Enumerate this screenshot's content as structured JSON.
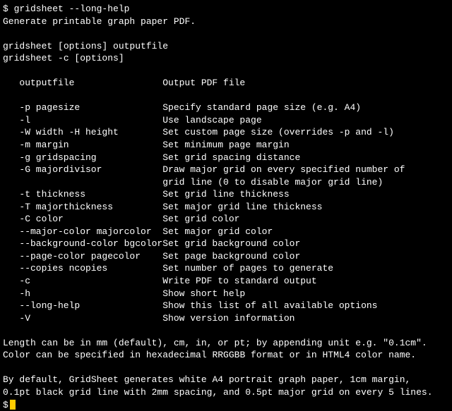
{
  "cmd_line": "$ gridsheet --long-help",
  "summary": "Generate printable graph paper PDF.",
  "usage1": "gridsheet [options] outputfile",
  "usage2": "gridsheet -c [options]",
  "options": [
    {
      "key": "outputfile",
      "desc": "Output PDF file"
    },
    {
      "key": "",
      "desc": ""
    },
    {
      "key": "-p pagesize",
      "desc": "Specify standard page size (e.g. A4)"
    },
    {
      "key": "-l",
      "desc": "Use landscape page"
    },
    {
      "key": "-W width -H height",
      "desc": "Set custom page size (overrides -p and -l)"
    },
    {
      "key": "-m margin",
      "desc": "Set minimum page margin"
    },
    {
      "key": "-g gridspacing",
      "desc": "Set grid spacing distance"
    },
    {
      "key": "-G majordivisor",
      "desc": "Draw major grid on every specified number of",
      "desc2": "grid line (0 to disable major grid line)"
    },
    {
      "key": "-t thickness",
      "desc": "Set grid line thickness"
    },
    {
      "key": "-T majorthickness",
      "desc": "Set major grid line thickness"
    },
    {
      "key": "-C color",
      "desc": "Set grid color"
    },
    {
      "key": "--major-color majorcolor",
      "desc": "Set major grid color"
    },
    {
      "key": "--background-color bgcolor",
      "desc": "Set grid background color"
    },
    {
      "key": "--page-color pagecolor",
      "desc": "Set page background color"
    },
    {
      "key": "--copies ncopies",
      "desc": "Set number of pages to generate"
    },
    {
      "key": "-c",
      "desc": "Write PDF to standard output"
    },
    {
      "key": "-h",
      "desc": "Show short help"
    },
    {
      "key": "--long-help",
      "desc": "Show this list of all available options"
    },
    {
      "key": "-V",
      "desc": "Show version information"
    }
  ],
  "notes1": "Length can be in mm (default), cm, in, or pt; by appending unit e.g. \"0.1cm\".",
  "notes2": "Color can be specified in hexadecimal RRGGBB format or in HTML4 color name.",
  "notes3": "By default, GridSheet generates white A4 portrait graph paper, 1cm margin,",
  "notes4": "0.1pt black grid line with 2mm spacing, and 0.5pt major grid on every 5 lines.",
  "prompt": "$"
}
